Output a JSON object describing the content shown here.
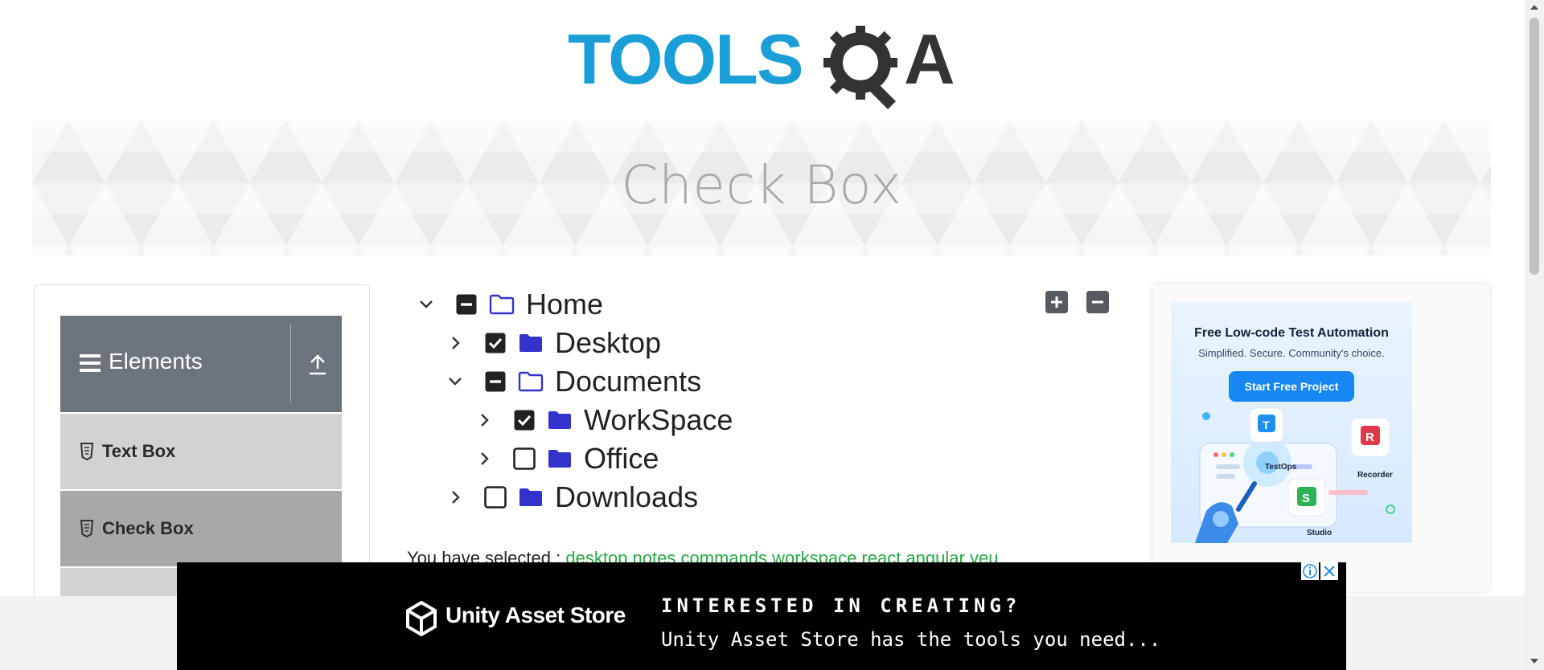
{
  "header": {
    "logo_text": "TOOLSQA"
  },
  "banner": {
    "title": "Check Box"
  },
  "sidebar": {
    "group_title": "Elements",
    "items": [
      {
        "label": "Text Box"
      },
      {
        "label": "Check Box"
      }
    ]
  },
  "tree": {
    "nodes": [
      {
        "label": "Home",
        "expanded": true,
        "state": "partial",
        "level": 0
      },
      {
        "label": "Desktop",
        "expanded": false,
        "state": "checked",
        "level": 1
      },
      {
        "label": "Documents",
        "expanded": true,
        "state": "partial",
        "level": 1
      },
      {
        "label": "WorkSpace",
        "expanded": false,
        "state": "checked",
        "level": 2,
        "highlighted": true
      },
      {
        "label": "Office",
        "expanded": false,
        "state": "unchecked",
        "level": 2
      },
      {
        "label": "Downloads",
        "expanded": false,
        "state": "unchecked",
        "level": 1
      }
    ],
    "expand_all_icon": "plus-square-icon",
    "collapse_all_icon": "minus-square-icon"
  },
  "result": {
    "prefix": "You have selected :",
    "items": "desktop notes commands workspace react angular veu"
  },
  "right_ad": {
    "title": "Free Low-code Test Automation",
    "subtitle": "Simplified. Secure. Community's choice.",
    "button": "Start Free Project",
    "labels": [
      "TestOps",
      "Recorder",
      "Studio"
    ]
  },
  "bottom_ad": {
    "brand": "Unity Asset Store",
    "headline": "INTERESTED IN CREATING?",
    "subline": "Unity Asset Store has the tools you need..."
  },
  "colors": {
    "folder": "#3333cc",
    "logo_blue": "#1a9ed8",
    "logo_dark": "#333333",
    "result_green": "#28a745",
    "sidebar_header": "#6c757d"
  }
}
